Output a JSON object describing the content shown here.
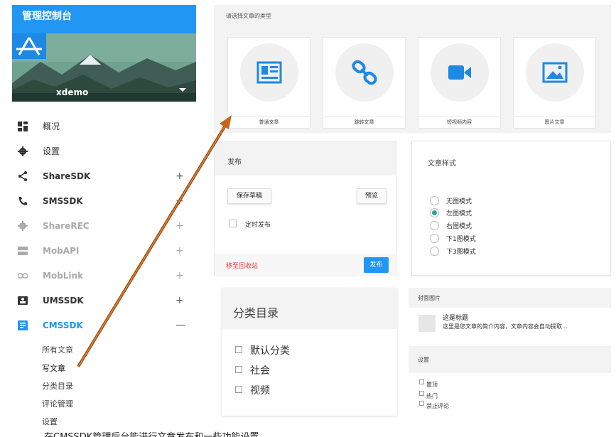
{
  "sidebar": {
    "title": "管理控制台",
    "user": "xdemo",
    "items": [
      {
        "label": "概况",
        "icon": "dashboard-icon",
        "expand": ""
      },
      {
        "label": "设置",
        "icon": "gear-icon",
        "expand": ""
      },
      {
        "label": "ShareSDK",
        "icon": "share-icon",
        "expand": "+"
      },
      {
        "label": "SMSSDK",
        "icon": "phone-icon",
        "expand": "+"
      },
      {
        "label": "ShareREC",
        "icon": "gear-icon",
        "expand": "+"
      },
      {
        "label": "MobAPI",
        "icon": "server-icon",
        "expand": "+"
      },
      {
        "label": "MobLink",
        "icon": "link-icon",
        "expand": "+"
      },
      {
        "label": "UMSSDK",
        "icon": "user-card-icon",
        "expand": "+"
      },
      {
        "label": "CMSSDK",
        "icon": "document-icon",
        "expand": "—"
      }
    ],
    "subitems": [
      "所有文章",
      "写文章",
      "分类目录",
      "评论管理",
      "设置"
    ]
  },
  "article_type": {
    "heading": "请选择文章的类型",
    "types": [
      {
        "label": "普通文章",
        "icon": "newspaper-icon"
      },
      {
        "label": "跳转文章",
        "icon": "link-icon"
      },
      {
        "label": "短视频内容",
        "icon": "video-camera-icon"
      },
      {
        "label": "图片文章",
        "icon": "image-icon"
      }
    ]
  },
  "publish": {
    "heading": "发布",
    "save_draft": "保存草稿",
    "preview": "预览",
    "schedule_label": "定时发布",
    "trash": "移至回收站",
    "publish_button": "发布"
  },
  "article_style": {
    "heading": "文章样式",
    "options": [
      "无图模式",
      "左图模式",
      "右图模式",
      "下1图模式",
      "下3图模式"
    ],
    "selected": "左图模式"
  },
  "category": {
    "heading": "分类目录",
    "items": [
      "默认分类",
      "社会",
      "视频"
    ]
  },
  "cover": {
    "heading": "封面图片",
    "title": "这是标题",
    "description": "这里是您文章的简介内容，文章内容会自动提取..."
  },
  "settings": {
    "heading": "设置",
    "options": [
      "置顶",
      "热门",
      "禁止评论"
    ]
  },
  "caption": "在CMSSDK管理后台能进行文章发布和一些功能设置",
  "colors": {
    "accent": "#2196f3",
    "arrow": "#c8641e",
    "radio_on": "#26a69a",
    "danger": "#e53935"
  }
}
